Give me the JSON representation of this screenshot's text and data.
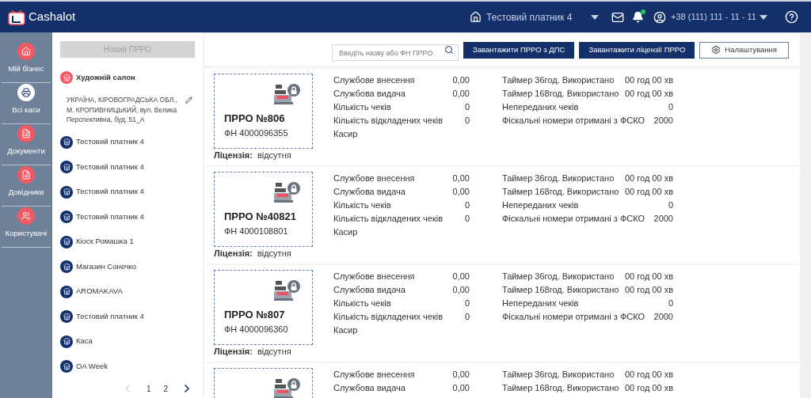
{
  "header": {
    "logo": "Cashalot",
    "company": "Тестовий платник 4",
    "notification_dot": true,
    "phone": "+38 (111) 111 - 11 - 11"
  },
  "rail": [
    {
      "label": "Мій бізнес",
      "selected": false
    },
    {
      "label": "Всі каси",
      "selected": true
    },
    {
      "label": "Документи",
      "selected": false
    },
    {
      "label": "Довідники",
      "selected": false
    },
    {
      "label": "Користувачі",
      "selected": false
    }
  ],
  "new_button": {
    "label": "Новий ПРРО",
    "disabled": true
  },
  "stores": [
    {
      "name": "Художній салон",
      "selected": true,
      "address": "УКРАЇНА, КІРОВОГРАДСЬКА ОБЛ., М. КРОПИВНИЦЬКИЙ, вул. Велика Перспективна, буд. 51_А"
    },
    {
      "name": "Тестовий платник 4",
      "selected": false
    },
    {
      "name": "Тестовий платник 4",
      "selected": false
    },
    {
      "name": "Тестовий платник 4",
      "selected": false
    },
    {
      "name": "Тестовий платник 4",
      "selected": false
    },
    {
      "name": "Кіоск Ромашка 1",
      "selected": false
    },
    {
      "name": "Магазин Сонечко",
      "selected": false
    },
    {
      "name": "AROMAKAVA",
      "selected": false
    },
    {
      "name": "Тестовий платник 4",
      "selected": false
    },
    {
      "name": "Каса",
      "selected": false
    },
    {
      "name": "OA Week",
      "selected": false
    }
  ],
  "pagination": {
    "prev_disabled": true,
    "pages": [
      "1",
      "2"
    ],
    "next_disabled": false
  },
  "toolbar": {
    "search_placeholder": "Введіть назву або ФН ПРРО",
    "buttons": [
      {
        "label": "Завантажити ПРРО з ДПС",
        "kind": "primary"
      },
      {
        "label": "Завантажити ліцензії ПРРО",
        "kind": "primary"
      },
      {
        "label": "Налаштування",
        "kind": "settings"
      }
    ]
  },
  "cards": [
    {
      "title": "ПРРО №806",
      "fn": "ФН 4000096355",
      "stats": [
        [
          "Службове внесення",
          "0,00"
        ],
        [
          "Службова видача",
          "0,00"
        ],
        [
          "Кількість чеків",
          "0"
        ],
        [
          "Кількість відкладених чеків",
          "0"
        ]
      ],
      "cashier": "Касир",
      "timers": [
        [
          "Таймер 36год. Використано",
          "00 год 00 хв"
        ],
        [
          "Таймер 168год. Використано",
          "00 год 00 хв"
        ],
        [
          "Непереданих чеків",
          "0"
        ],
        [
          "Фіскальні номери отримані з ФСКО",
          "2000"
        ]
      ],
      "license_label": "Ліцензія:",
      "license": "відсутня"
    },
    {
      "title": "ПРРО №40821",
      "fn": "ФН 4000108801",
      "stats": [
        [
          "Службове внесення",
          "0,00"
        ],
        [
          "Службова видача",
          "0,00"
        ],
        [
          "Кількість чеків",
          "0"
        ],
        [
          "Кількість відкладених чеків",
          "0"
        ]
      ],
      "cashier": "Касир",
      "timers": [
        [
          "Таймер 36год. Використано",
          "00 год 00 хв"
        ],
        [
          "Таймер 168год. Використано",
          "00 год 00 хв"
        ],
        [
          "Непереданих чеків",
          "0"
        ],
        [
          "Фіскальні номери отримані з ФСКО",
          "2000"
        ]
      ],
      "license_label": "Ліцензія:",
      "license": "відсутня"
    },
    {
      "title": "ПРРО №807",
      "fn": "ФН 4000096360",
      "stats": [
        [
          "Службове внесення",
          "0,00"
        ],
        [
          "Службова видача",
          "0,00"
        ],
        [
          "Кількість чеків",
          "0"
        ],
        [
          "Кількість відкладених чеків",
          "0"
        ]
      ],
      "cashier": "Касир",
      "timers": [
        [
          "Таймер 36год. Використано",
          "00 год 00 хв"
        ],
        [
          "Таймер 168год. Використано",
          "00 год 00 хв"
        ],
        [
          "Непереданих чеків",
          "0"
        ],
        [
          "Фіскальні номери отримані з ФСКО",
          "2000"
        ]
      ],
      "license_label": "Ліцензія:",
      "license": "відсутня"
    },
    {
      "stats": [
        [
          "Службове внесення",
          "0,00"
        ],
        [
          "Службова видача",
          "0,00"
        ]
      ],
      "timers": [
        [
          "Таймер 36год. Використано",
          "00 год 00 хв"
        ],
        [
          "Таймер 168год. Використано",
          "00 год 00 хв"
        ]
      ]
    }
  ]
}
